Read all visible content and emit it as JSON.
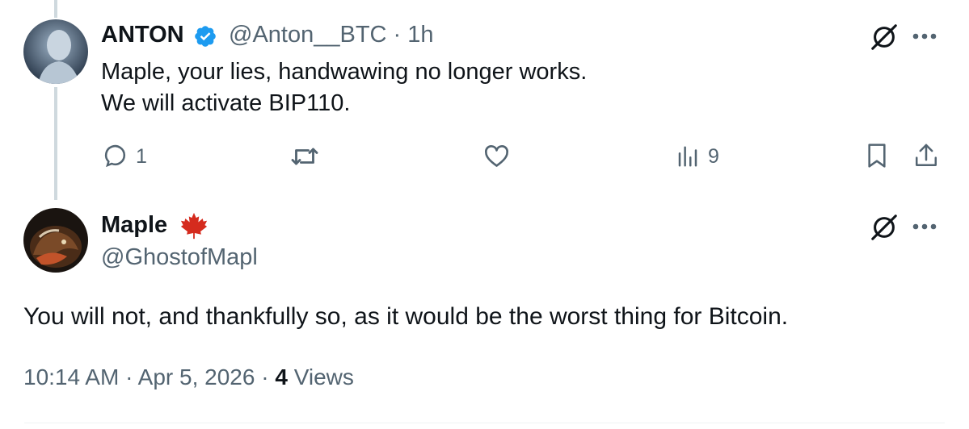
{
  "reply_to": {
    "author_name": "ANTON",
    "handle_time": "@Anton__BTC · 1h",
    "text_line1": "Maple, your lies, handwawing no longer works.",
    "text_line2": "We will activate BIP110.",
    "reply_count": "1",
    "view_count": "9"
  },
  "main_tweet": {
    "author_name": "Maple",
    "handle": "@GhostofMapl",
    "text": "You will not, and thankfully so, as it would be the worst thing for Bitcoin.",
    "time": "10:14 AM",
    "dot1": "·",
    "date": "Apr 5, 2026",
    "dot2": "·",
    "views_count": "4",
    "views_label": "Views"
  },
  "colors": {
    "verified_blue": "#1d9bf0",
    "maple_red": "#e0245e",
    "secondary_text": "#536471",
    "primary_text": "#0f1419"
  },
  "icons": [
    "verified-badge-icon",
    "grok-icon",
    "more-icon",
    "reply-icon",
    "retweet-icon",
    "like-icon",
    "views-icon",
    "bookmark-icon",
    "share-icon",
    "maple-leaf-icon"
  ]
}
